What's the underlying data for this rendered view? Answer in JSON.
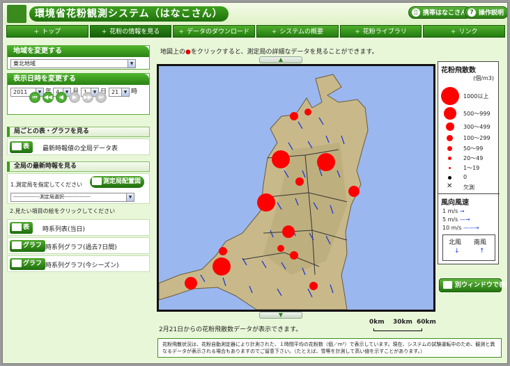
{
  "header": {
    "title": "環境省花粉観測システム（はなこさん）",
    "mobile_label": "携帯はなこさん",
    "help_label": "操作説明"
  },
  "nav": {
    "tabs": [
      {
        "label": "トップ"
      },
      {
        "label": "花粉の情報を見る"
      },
      {
        "label": "データのダウンロード"
      },
      {
        "label": "システムの概要"
      },
      {
        "label": "花粉ライブラリ"
      },
      {
        "label": "リンク"
      }
    ]
  },
  "region": {
    "heading": "地域を変更する",
    "selected": "東北地域"
  },
  "datetime": {
    "heading": "表示日時を変更する",
    "year": "2011",
    "year_unit": "年",
    "month": "4",
    "month_unit": "月",
    "day": "1",
    "day_unit": "日",
    "hour": "21",
    "hour_unit": "時"
  },
  "station_table": {
    "heading": "局ごとの表・グラフを見る",
    "button": "表",
    "text": "最新時報値の全局データ表"
  },
  "latest": {
    "heading": "全局の最新時報を見る",
    "step1": "1.測定局を指定してください",
    "map_button": "測定局配置図",
    "station_select": "---------------測定局選択---------------",
    "step2": "2.見たい項目の絵をクリックしてください",
    "items": [
      {
        "button": "表",
        "text": "時系列表(当日)"
      },
      {
        "button": "グラフ",
        "text": "時系列グラフ(過去7日間)"
      },
      {
        "button": "グラフ",
        "text": "時系列グラフ(今シーズン)"
      }
    ]
  },
  "map": {
    "instruction_pre": "地図上の",
    "instruction_dot": "●",
    "instruction_post": "をクリックすると、測定局の詳細なデータを見ることができます。",
    "status": "2月21日からの花粉飛散数データが表示できます。"
  },
  "legend": {
    "title": "花粉飛散数",
    "unit": "(個/m3)",
    "levels": [
      {
        "label": "1000以上"
      },
      {
        "label": "500〜999"
      },
      {
        "label": "300〜499"
      },
      {
        "label": "100〜299"
      },
      {
        "label": "50〜99"
      },
      {
        "label": "20〜49"
      },
      {
        "label": "1〜19"
      },
      {
        "label": "0"
      },
      {
        "label": "欠測"
      }
    ],
    "wind_title": "風向風速",
    "wind_rows": [
      "1 m/s",
      "5 m/s",
      "10 m/s"
    ],
    "north_wind": "北風",
    "south_wind": "南風"
  },
  "new_window_button": "別ウィンドウで表示",
  "scale": {
    "labels": [
      "0km",
      "30km",
      "60km"
    ]
  },
  "note": "花粉飛散状況は、花粉自動測定器により計測された、１時間平均の花粉数（個／m³）で表示しています。現在、システムの試験運転中のため、観測と異なるデータが表示される場合もありますのでご留意下さい。（たとえば、雪等を計測して高い値を示すことがあります。）",
  "colors": {
    "accent": "#2b8014",
    "pollen": "#ff0000",
    "wind": "#1f3bd6",
    "sea": "#9ab7ef"
  },
  "icons": [
    "mobile-icon",
    "help-icon",
    "table-icon",
    "graph-icon",
    "window-icon"
  ]
}
